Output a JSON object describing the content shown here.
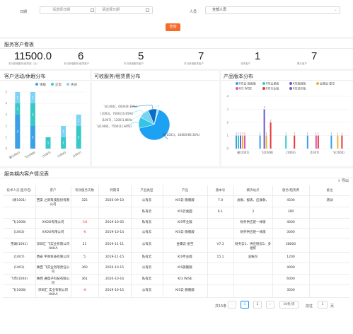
{
  "filters": {
    "date_label": "日期",
    "start_placeholder": "请选择日期",
    "end_placeholder": "请选择日期",
    "person_label": "人员",
    "person_value": "全部人员",
    "query_button": "查询"
  },
  "board": {
    "title": "服务客户看板",
    "kpis": [
      {
        "value": "11500.0",
        "label": "本月新增服务/租赁费（元）"
      },
      {
        "value": "6",
        "label": "本月新增服务/租赁客户"
      },
      {
        "value": "5",
        "label": "本月新增服务客户"
      },
      {
        "value": "7",
        "label": "本月新增租赁客户"
      },
      {
        "value": "1",
        "label": "流失客户"
      },
      {
        "value": "7",
        "label": "累计客户"
      }
    ]
  },
  "activity_chart": {
    "title": "客户活动/休眠分布",
    "legend": [
      "休眠",
      "正常",
      "失效"
    ],
    "colors": [
      "#3aa0e8",
      "#39c8c8",
      "#7ed3f4"
    ],
    "categories": [
      "谢(1001)",
      "飞(1008)",
      "(1003)",
      "(1004)",
      "(1007)"
    ],
    "series": [
      {
        "name": "休眠",
        "values": [
          3,
          2,
          0,
          0,
          0
        ]
      },
      {
        "name": "正常",
        "values": [
          1,
          2,
          1,
          1,
          2
        ]
      },
      {
        "name": "失效",
        "values": [
          1,
          1,
          0,
          1,
          1
        ]
      }
    ],
    "labels": [
      "4",
      "1",
      "5",
      "1",
      "2",
      "2"
    ]
  },
  "pie_chart": {
    "title": "可收服务/租赁费分布",
    "type": "pie",
    "slices": [
      {
        "label": "谢(1001)",
        "value": 42800,
        "text": "谢(1001)，42800(66.36%)"
      },
      {
        "label": "飞(1008)",
        "value": 7500,
        "text": "飞(1008)，7500(11.63%)"
      },
      {
        "label": "(1003)",
        "value": 7000,
        "text": "(1003)，7000(10.85%)"
      },
      {
        "label": "飞(1004)",
        "value": 6000,
        "text": "飞(1004)，6000(9.30%)"
      },
      {
        "label": "(1007)",
        "value": 1200,
        "text": "(1007)，1200(1.86%)"
      }
    ],
    "colors": [
      "#1da1f2",
      "#35c3e6",
      "#74d5f2",
      "#0a6ec6",
      "#a8e4f6"
    ]
  },
  "product_chart": {
    "title": "产品版本分布",
    "legend": [
      {
        "name": "KIS云-旗舰版",
        "color": "#3aa0e8"
      },
      {
        "name": "KIS云桌面",
        "color": "#39c8c8"
      },
      {
        "name": "KIS旗舰版",
        "color": "#6a5acd"
      },
      {
        "name": "金蝶云·星空",
        "color": "#f2b134"
      },
      {
        "name": "K/3 WISE",
        "color": "#d65db1"
      },
      {
        "name": "KIS专业版",
        "color": "#e53935"
      },
      {
        "name": "KIS进存版",
        "color": "#7e57c2"
      }
    ],
    "categories": [
      "谢(1001)",
      "飞(1008)",
      "(1003)",
      "(1007)",
      "飞(1004)"
    ],
    "ylim": [
      0,
      4
    ],
    "values": [
      [
        1,
        1,
        1,
        1,
        1,
        0,
        0
      ],
      [
        1,
        0,
        3,
        1,
        0,
        2,
        0
      ],
      [
        0,
        1,
        0,
        0,
        0,
        1,
        0
      ],
      [
        1,
        0,
        0,
        0,
        1,
        1,
        0
      ],
      [
        1,
        0,
        0,
        1,
        0,
        1,
        0
      ]
    ],
    "top_labels": [
      "111",
      "3",
      "2",
      "1"
    ]
  },
  "table": {
    "title": "服务期内客户情况表",
    "export": "导出",
    "columns": [
      "技术人员(显示名)",
      "客户",
      "有效服务天数",
      "到期日",
      "产品类型",
      "产品",
      "版本号",
      "模块站点",
      "服务/租赁费",
      "备注"
    ],
    "rows": [
      [
        "(谢1001)",
        "西安    之新科技股份有限公司",
        "325",
        "2020-09-10",
        "公有云",
        "KIS云-旗舰版",
        "7.0",
        "总账、报表、应收款、",
        "4500",
        "测试"
      ],
      [
        "",
        "",
        "",
        "",
        "私有云",
        "KIS云桌面",
        "6.1",
        "3",
        "300",
        ""
      ],
      [
        "飞(1008)",
        "XXOO有限公司",
        "-18",
        "2019-10-05",
        "私有云",
        "KIS专业版",
        "",
        "财务供应链一体版",
        "4000",
        ""
      ],
      [
        "(1003)",
        "XXOO有限公司",
        "-6",
        "2019-10-14",
        "公有云",
        "KIS云-旗舰版",
        "",
        "财务供应链一体版",
        "3000",
        ""
      ],
      [
        "雪湖(1001)",
        "深圳汇    飞实业有限公司HAHA",
        "21",
        "2019-11-11",
        "公有云",
        "金蝶云·星空",
        "V7.3",
        "财务云1、供应链云5、多组织",
        "38000",
        ""
      ],
      [
        "(1007)",
        "西安    宇商科技有限公司",
        "5",
        "2019-11-15",
        "私有云",
        "KIS专业版",
        "15.1",
        "总账包",
        "1200",
        ""
      ],
      [
        "(1003)",
        "陕西    飞实业有限责任公司",
        "360",
        "2020-10-15",
        "公有云",
        "KIS旗舰版",
        "",
        "",
        "4000",
        ""
      ],
      [
        "飞市(1004)",
        "陕西    通电子科技有限公司",
        "361",
        "2020-10-16",
        "私有云",
        "K/3 WISE",
        "",
        "",
        "6000",
        ""
      ],
      [
        "飞(1008)",
        "深圳汇    实业有限公司HAHA",
        "-6",
        "2019-10-15",
        "公有云",
        "KIS云-旗舰版",
        "",
        "",
        "3500",
        ""
      ]
    ],
    "negative_flags": [
      false,
      false,
      true,
      true,
      false,
      false,
      false,
      false,
      true
    ]
  },
  "pagination": {
    "total": "共15条",
    "pages": [
      "1",
      "2"
    ],
    "page_size": "10条/页",
    "goto_label": "前往",
    "goto_value": "1",
    "page_suffix": "页"
  }
}
